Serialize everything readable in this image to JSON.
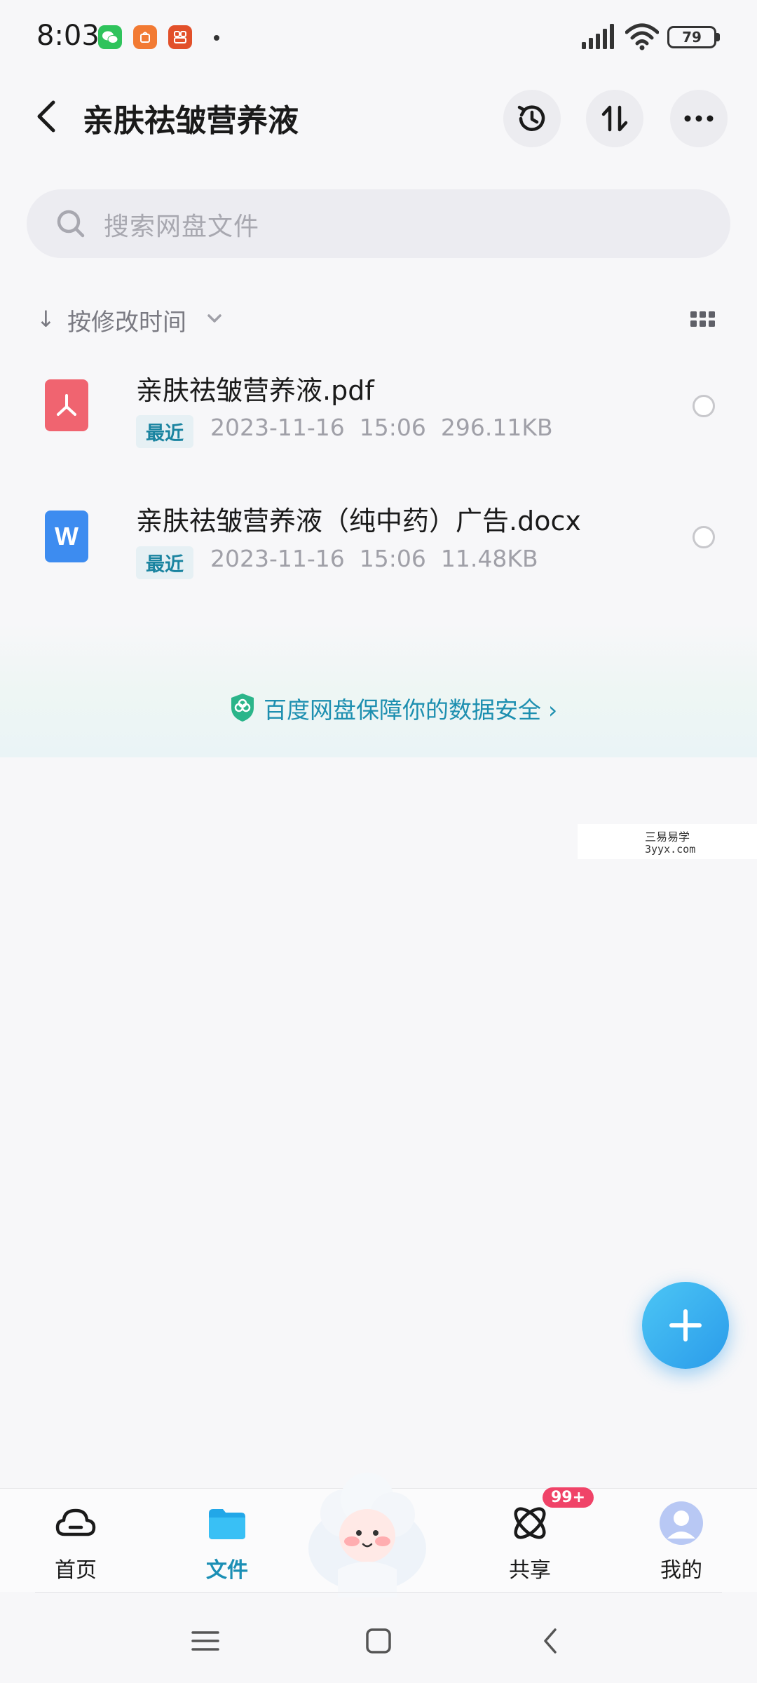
{
  "status_bar": {
    "time": "8:03",
    "battery": "79",
    "apps": [
      {
        "name": "wechat-icon",
        "color": "#2fc35c"
      },
      {
        "name": "taobao-icon",
        "color": "#f27a33"
      },
      {
        "name": "xiaohongshu-icon",
        "color": "#ef5a28"
      }
    ]
  },
  "header": {
    "title": "亲肤祛皱营养液",
    "buttons": [
      "history-icon",
      "transfer-icon",
      "more-icon"
    ]
  },
  "search": {
    "placeholder": "搜索网盘文件"
  },
  "sort": {
    "label": "按修改时间"
  },
  "files": [
    {
      "name": "亲肤祛皱营养液.pdf",
      "tag": "最近",
      "date": "2023-11-16",
      "time": "15:06",
      "size": "296.11KB",
      "icon": "pdf-icon",
      "color": "#f06470"
    },
    {
      "name": "亲肤祛皱营养液（纯中药）广告.docx",
      "tag": "最近",
      "date": "2023-11-16",
      "time": "15:06",
      "size": "11.48KB",
      "icon": "word-icon",
      "color": "#3d8cf0"
    }
  ],
  "banner": {
    "text": "百度网盘保障你的数据安全"
  },
  "watermark": {
    "line1": "三易易学",
    "line2": "3yyx.com"
  },
  "bottom_nav": {
    "items": [
      {
        "label": "首页",
        "icon": "home-cloud-icon"
      },
      {
        "label": "文件",
        "icon": "folder-icon",
        "active": true
      },
      {
        "label": "",
        "icon": "mascot-icon"
      },
      {
        "label": "共享",
        "icon": "share-icon"
      },
      {
        "label": "我的",
        "icon": "profile-icon"
      }
    ],
    "share_badge": "99+"
  },
  "colors": {
    "accent": "#1b8fb5",
    "fab": "#2a9bea",
    "badge": "#f04368"
  }
}
